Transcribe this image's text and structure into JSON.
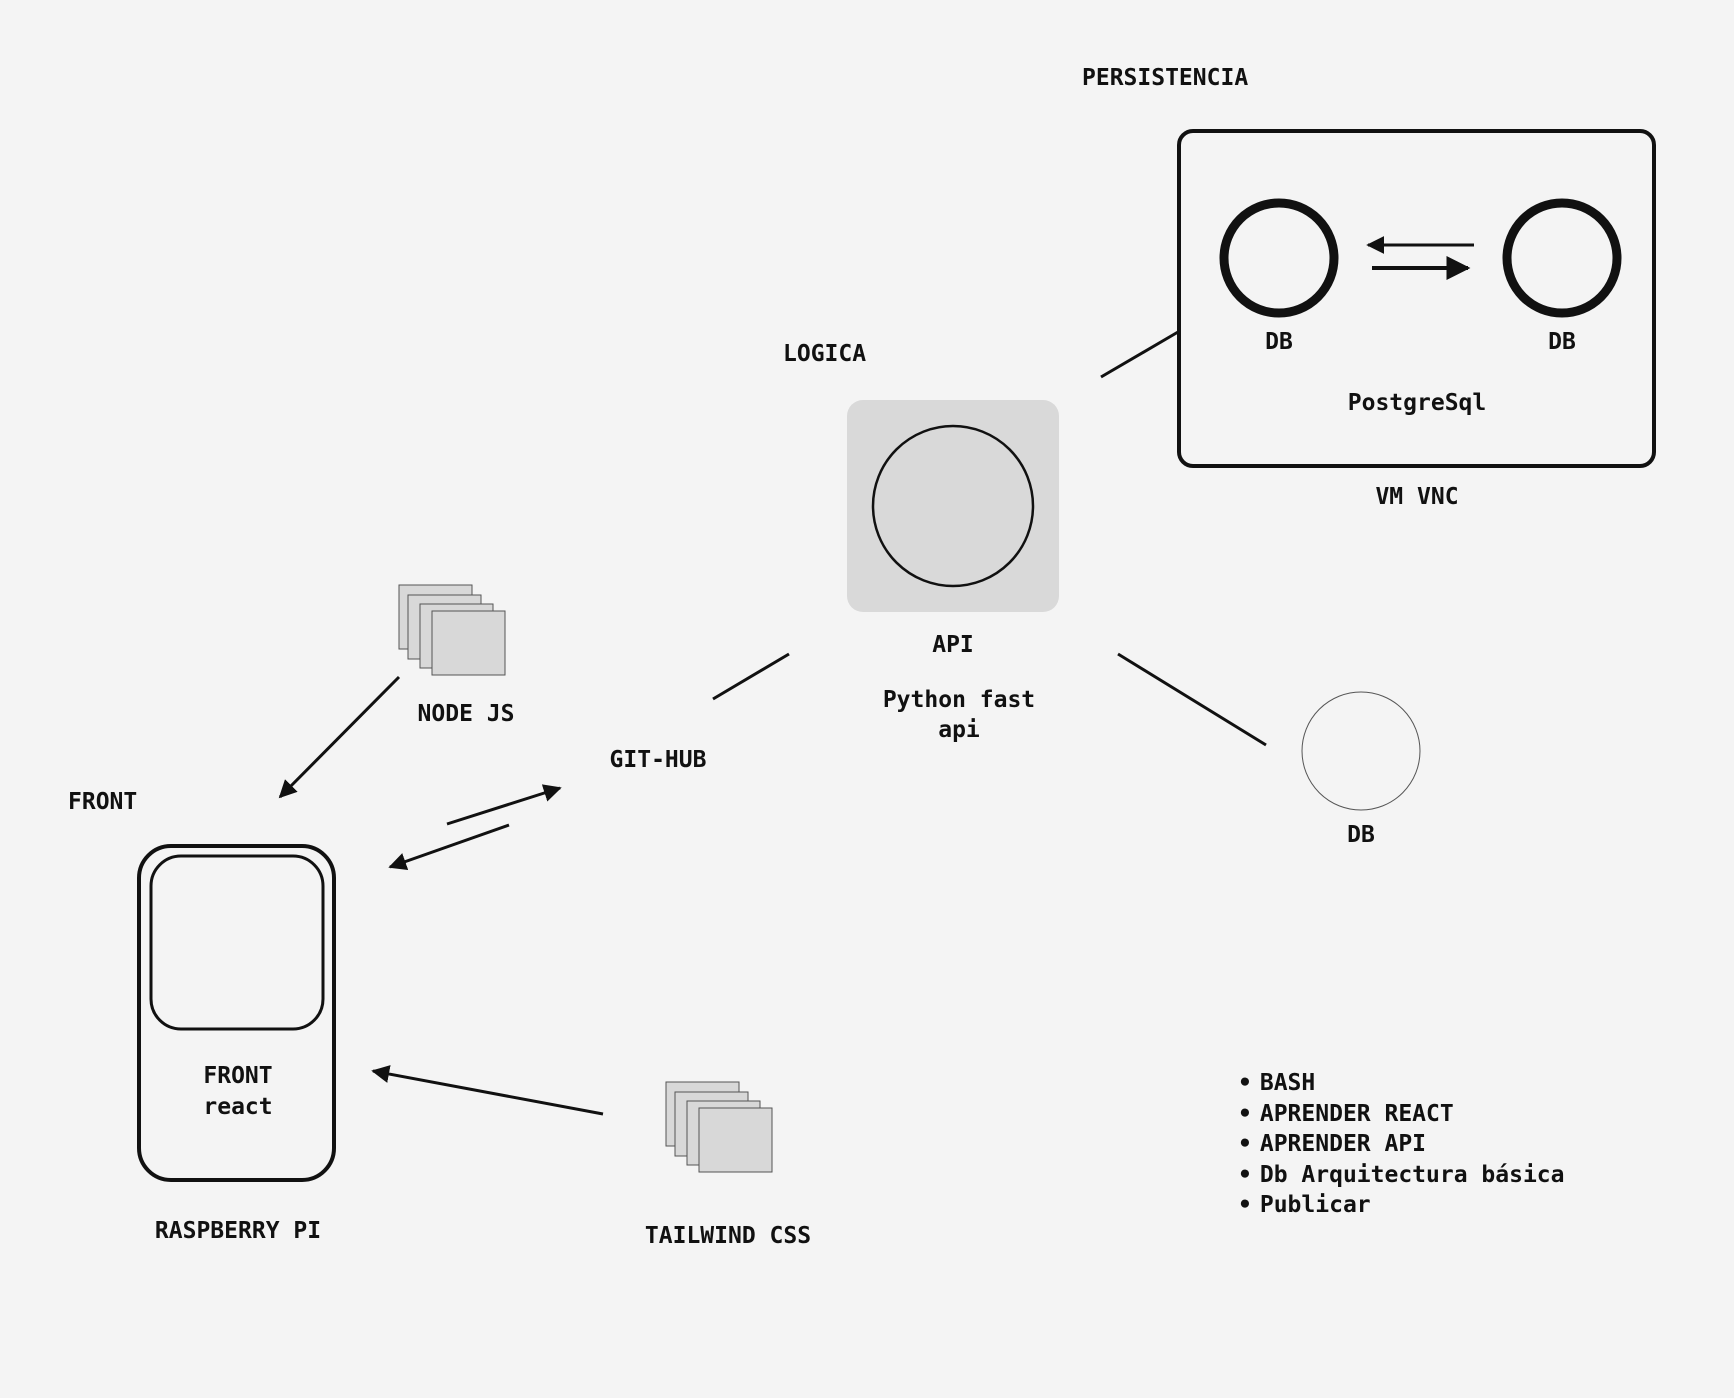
{
  "sections": {
    "persistencia": "PERSISTENCIA",
    "logica": "LOGICA",
    "front": "FRONT"
  },
  "persistence_box": {
    "db_left": "DB",
    "db_right": "DB",
    "engine": "PostgreSql",
    "host": "VM VNC"
  },
  "api_node": {
    "label": "API",
    "tech_line1": "Python fast",
    "tech_line2": "api"
  },
  "standalone_db": "DB",
  "node_js": "NODE JS",
  "github": "GIT-HUB",
  "front_device": {
    "line1": "FRONT",
    "line2": "react",
    "host": "RASPBERRY PI"
  },
  "tailwind": "TAILWIND CSS",
  "todo": [
    "BASH",
    "APRENDER REACT",
    "APRENDER API",
    "Db Arquitectura básica",
    "Publicar"
  ],
  "colors": {
    "background": "#f4f4f4",
    "stroke": "#111111",
    "api_square_fill": "#d9d9d9",
    "stack_fill": "#d8d8d8"
  }
}
